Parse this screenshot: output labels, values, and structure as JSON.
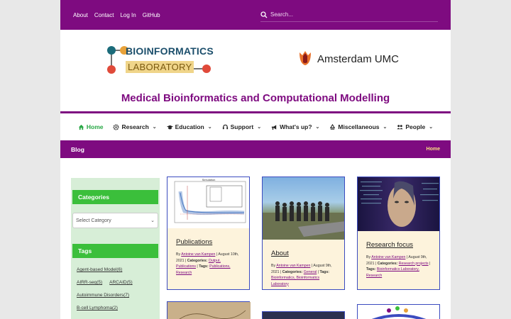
{
  "topbar": {
    "links": [
      "About",
      "Contact",
      "Log In",
      "GitHub"
    ],
    "search_placeholder": "Search..."
  },
  "header": {
    "logo_line1": "BIOINFORMATICS",
    "logo_line2": "LABORATORY",
    "partner": "Amsterdam UMC",
    "site_title": "Medical Bioinformatics and Computational Modelling"
  },
  "nav": {
    "items": [
      "Home",
      "Research",
      "Education",
      "Support",
      "What's up?",
      "Miscellaneous",
      "People"
    ]
  },
  "blogbar": {
    "title": "Blog",
    "crumb": "Home"
  },
  "sidebar": {
    "categories_heading": "Categories",
    "select_value": "Select Category",
    "tags_heading": "Tags",
    "tags": [
      "Agent-based Model",
      "(6)",
      "AIRR-seq",
      "(5)",
      "ARCAID",
      "(5)",
      "Autoimmune Disorders",
      "(7)",
      "B-cell Lymphoma",
      "(2)"
    ]
  },
  "posts": [
    {
      "title": "Publications",
      "by": "By",
      "author": "Antoine van Kampen",
      "date": "August 10th, 2021",
      "cat_label": "Categories:",
      "categories": "Output, Publications",
      "tags_label": "Tags:",
      "tags": "Publications, Research"
    },
    {
      "title": "About",
      "by": "By",
      "author": "Antoine van Kampen",
      "date": "August 9th, 2021",
      "cat_label": "Categories:",
      "categories": "General",
      "tags_label": "Tags:",
      "tags": "Bioinformatics, Bioinformatics Laboratory"
    },
    {
      "title": "Research focus",
      "by": "By",
      "author": "Antoine van Kampen",
      "date": "August 9th, 2021",
      "cat_label": "Categories:",
      "categories": "Research projects",
      "tags_label": "Tags:",
      "tags": "Bioinformatics Laboratory, Research"
    }
  ],
  "figure": {
    "title": "Simulation"
  },
  "colors": {
    "purple": "#7e0b80",
    "green": "#3bbf3b",
    "card_bg": "#fdf3dc",
    "sidebar_bg": "#d7eed7"
  }
}
